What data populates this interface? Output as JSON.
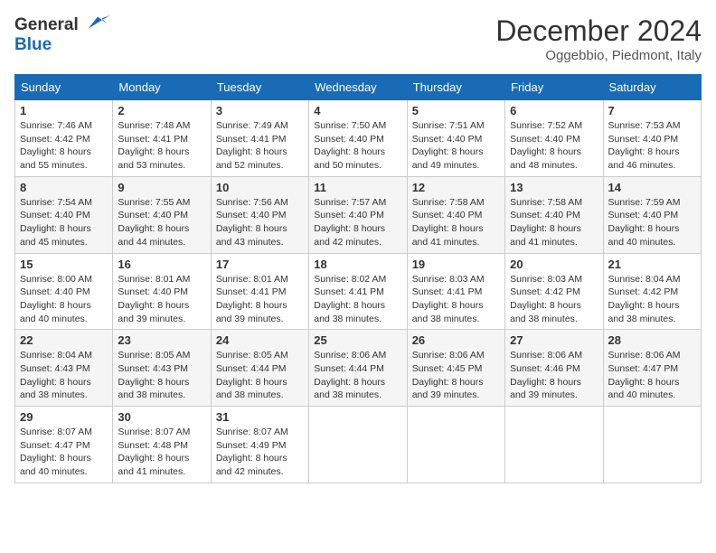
{
  "header": {
    "logo_line1": "General",
    "logo_line2": "Blue",
    "month": "December 2024",
    "location": "Oggebbio, Piedmont, Italy"
  },
  "weekdays": [
    "Sunday",
    "Monday",
    "Tuesday",
    "Wednesday",
    "Thursday",
    "Friday",
    "Saturday"
  ],
  "weeks": [
    [
      {
        "day": "1",
        "sunrise": "7:46 AM",
        "sunset": "4:42 PM",
        "daylight": "8 hours and 55 minutes."
      },
      {
        "day": "2",
        "sunrise": "7:48 AM",
        "sunset": "4:41 PM",
        "daylight": "8 hours and 53 minutes."
      },
      {
        "day": "3",
        "sunrise": "7:49 AM",
        "sunset": "4:41 PM",
        "daylight": "8 hours and 52 minutes."
      },
      {
        "day": "4",
        "sunrise": "7:50 AM",
        "sunset": "4:40 PM",
        "daylight": "8 hours and 50 minutes."
      },
      {
        "day": "5",
        "sunrise": "7:51 AM",
        "sunset": "4:40 PM",
        "daylight": "8 hours and 49 minutes."
      },
      {
        "day": "6",
        "sunrise": "7:52 AM",
        "sunset": "4:40 PM",
        "daylight": "8 hours and 48 minutes."
      },
      {
        "day": "7",
        "sunrise": "7:53 AM",
        "sunset": "4:40 PM",
        "daylight": "8 hours and 46 minutes."
      }
    ],
    [
      {
        "day": "8",
        "sunrise": "7:54 AM",
        "sunset": "4:40 PM",
        "daylight": "8 hours and 45 minutes."
      },
      {
        "day": "9",
        "sunrise": "7:55 AM",
        "sunset": "4:40 PM",
        "daylight": "8 hours and 44 minutes."
      },
      {
        "day": "10",
        "sunrise": "7:56 AM",
        "sunset": "4:40 PM",
        "daylight": "8 hours and 43 minutes."
      },
      {
        "day": "11",
        "sunrise": "7:57 AM",
        "sunset": "4:40 PM",
        "daylight": "8 hours and 42 minutes."
      },
      {
        "day": "12",
        "sunrise": "7:58 AM",
        "sunset": "4:40 PM",
        "daylight": "8 hours and 41 minutes."
      },
      {
        "day": "13",
        "sunrise": "7:58 AM",
        "sunset": "4:40 PM",
        "daylight": "8 hours and 41 minutes."
      },
      {
        "day": "14",
        "sunrise": "7:59 AM",
        "sunset": "4:40 PM",
        "daylight": "8 hours and 40 minutes."
      }
    ],
    [
      {
        "day": "15",
        "sunrise": "8:00 AM",
        "sunset": "4:40 PM",
        "daylight": "8 hours and 40 minutes."
      },
      {
        "day": "16",
        "sunrise": "8:01 AM",
        "sunset": "4:40 PM",
        "daylight": "8 hours and 39 minutes."
      },
      {
        "day": "17",
        "sunrise": "8:01 AM",
        "sunset": "4:41 PM",
        "daylight": "8 hours and 39 minutes."
      },
      {
        "day": "18",
        "sunrise": "8:02 AM",
        "sunset": "4:41 PM",
        "daylight": "8 hours and 38 minutes."
      },
      {
        "day": "19",
        "sunrise": "8:03 AM",
        "sunset": "4:41 PM",
        "daylight": "8 hours and 38 minutes."
      },
      {
        "day": "20",
        "sunrise": "8:03 AM",
        "sunset": "4:42 PM",
        "daylight": "8 hours and 38 minutes."
      },
      {
        "day": "21",
        "sunrise": "8:04 AM",
        "sunset": "4:42 PM",
        "daylight": "8 hours and 38 minutes."
      }
    ],
    [
      {
        "day": "22",
        "sunrise": "8:04 AM",
        "sunset": "4:43 PM",
        "daylight": "8 hours and 38 minutes."
      },
      {
        "day": "23",
        "sunrise": "8:05 AM",
        "sunset": "4:43 PM",
        "daylight": "8 hours and 38 minutes."
      },
      {
        "day": "24",
        "sunrise": "8:05 AM",
        "sunset": "4:44 PM",
        "daylight": "8 hours and 38 minutes."
      },
      {
        "day": "25",
        "sunrise": "8:06 AM",
        "sunset": "4:44 PM",
        "daylight": "8 hours and 38 minutes."
      },
      {
        "day": "26",
        "sunrise": "8:06 AM",
        "sunset": "4:45 PM",
        "daylight": "8 hours and 39 minutes."
      },
      {
        "day": "27",
        "sunrise": "8:06 AM",
        "sunset": "4:46 PM",
        "daylight": "8 hours and 39 minutes."
      },
      {
        "day": "28",
        "sunrise": "8:06 AM",
        "sunset": "4:47 PM",
        "daylight": "8 hours and 40 minutes."
      }
    ],
    [
      {
        "day": "29",
        "sunrise": "8:07 AM",
        "sunset": "4:47 PM",
        "daylight": "8 hours and 40 minutes."
      },
      {
        "day": "30",
        "sunrise": "8:07 AM",
        "sunset": "4:48 PM",
        "daylight": "8 hours and 41 minutes."
      },
      {
        "day": "31",
        "sunrise": "8:07 AM",
        "sunset": "4:49 PM",
        "daylight": "8 hours and 42 minutes."
      },
      null,
      null,
      null,
      null
    ]
  ],
  "labels": {
    "sunrise": "Sunrise:",
    "sunset": "Sunset:",
    "daylight": "Daylight:"
  }
}
